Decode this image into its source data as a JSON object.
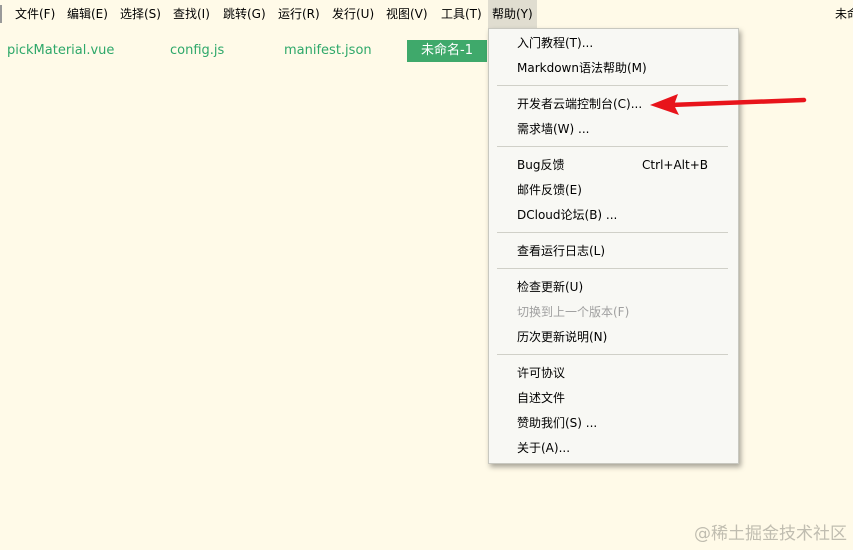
{
  "menubar": {
    "items": [
      {
        "label": "文件(F)"
      },
      {
        "label": "编辑(E)"
      },
      {
        "label": "选择(S)"
      },
      {
        "label": "查找(I)"
      },
      {
        "label": "跳转(G)"
      },
      {
        "label": "运行(R)"
      },
      {
        "label": "发行(U)"
      },
      {
        "label": "视图(V)"
      },
      {
        "label": "工具(T)"
      },
      {
        "label": "帮助(Y)"
      }
    ],
    "right_text": "未命"
  },
  "tabs": [
    {
      "label": "pickMaterial.vue"
    },
    {
      "label": "config.js"
    },
    {
      "label": "manifest.json"
    },
    {
      "label": "未命名-1"
    }
  ],
  "help_menu": {
    "groups": [
      [
        {
          "label": "入门教程(T)..."
        },
        {
          "label": "Markdown语法帮助(M)"
        }
      ],
      [
        {
          "label": "开发者云端控制台(C)..."
        },
        {
          "label": "需求墙(W) ..."
        }
      ],
      [
        {
          "label": "Bug反馈",
          "shortcut": "Ctrl+Alt+B"
        },
        {
          "label": "邮件反馈(E)"
        },
        {
          "label": "DCloud论坛(B) ..."
        }
      ],
      [
        {
          "label": "查看运行日志(L)"
        }
      ],
      [
        {
          "label": "检查更新(U)"
        },
        {
          "label": "切换到上一个版本(F)"
        },
        {
          "label": "历次更新说明(N)"
        }
      ],
      [
        {
          "label": "许可协议"
        },
        {
          "label": "自述文件"
        },
        {
          "label": "赞助我们(S) ..."
        },
        {
          "label": "关于(A)..."
        }
      ]
    ]
  },
  "annotation": {
    "arrow_color": "#e8141b"
  },
  "colors": {
    "background": "#fffae8",
    "tab_text": "#2ea86a",
    "active_tab": "#3fa96b"
  },
  "watermark": "@稀土掘金技术社区"
}
